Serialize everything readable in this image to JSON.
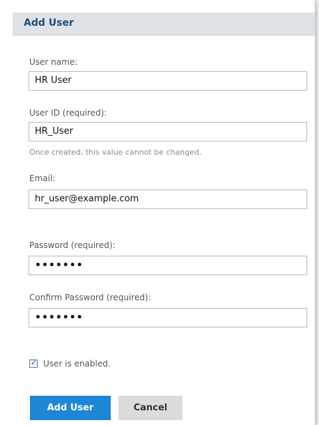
{
  "dialog": {
    "title": "Add User"
  },
  "fields": {
    "user_name": {
      "label": "User name:",
      "value": "HR User"
    },
    "user_id": {
      "label": "User ID (required):",
      "value": "HR_User",
      "hint": "Once created, this value cannot be changed."
    },
    "email": {
      "label": "Email:",
      "value": "hr_user@example.com"
    },
    "password": {
      "label": "Password (required):",
      "value": "•••••••"
    },
    "confirm_password": {
      "label": "Confirm Password (required):",
      "value": "•••••••"
    }
  },
  "enabled": {
    "label": "User is enabled.",
    "checked": true
  },
  "buttons": {
    "add": "Add User",
    "cancel": "Cancel"
  },
  "colors": {
    "header_bg": "#dfe3e8",
    "title": "#1f4e79",
    "primary": "#1d87d6",
    "secondary": "#dcdcdc"
  }
}
